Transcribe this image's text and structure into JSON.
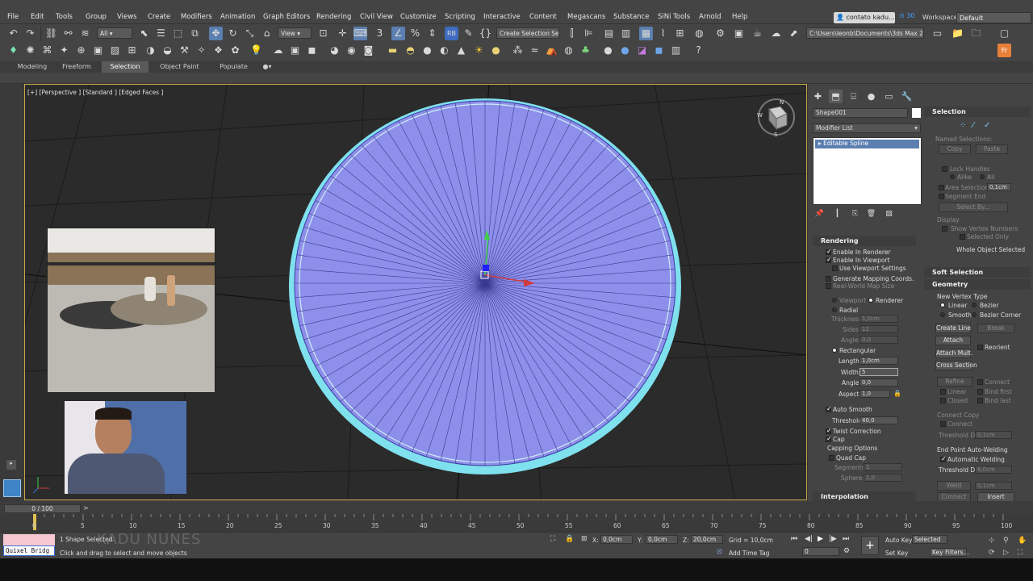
{
  "menu": [
    "File",
    "Edit",
    "Tools",
    "Group",
    "Views",
    "Create",
    "Modifiers",
    "Animation",
    "Graph Editors",
    "Rendering",
    "Civil View",
    "Customize",
    "Scripting",
    "Interactive",
    "Content",
    "Megascans",
    "Substance",
    "SiNi Tools",
    "Arnold",
    "Help"
  ],
  "account": "contato kadu...",
  "help_count": "30",
  "workspaces_label": "Workspaces:",
  "workspace": "Default",
  "toolbar": {
    "filter": "All",
    "ref_coord": "View",
    "selection_set": "Create Selection Se",
    "project_path": "C:\\Users\\leonb\\Documents\\3ds Max 2021"
  },
  "ribbon_tabs": [
    "Modeling",
    "Freeform",
    "Selection",
    "Object Paint",
    "Populate"
  ],
  "viewport_label": "[+] [Perspective ] [Standard ] [Edged Faces ]",
  "viewcube": {
    "n": "N",
    "s": "S",
    "w": "W"
  },
  "command_panel": {
    "object_name": "Shape001",
    "modifier_list": "Modifier List",
    "stack_item": "Editable Spline",
    "rendering": {
      "title": "Rendering",
      "enable_renderer": "Enable In Renderer",
      "enable_viewport": "Enable In Viewport",
      "use_viewport_settings": "Use Viewport Settings",
      "gen_mapping": "Generate Mapping Coords.",
      "real_world": "Real-World Map Size",
      "viewport": "Viewport",
      "renderer": "Renderer",
      "radial": "Radial",
      "thickness_label": "Thickness:",
      "thickness": "1,0cm",
      "sides_label": "Sides:",
      "sides": "12",
      "angle_label": "Angle:",
      "angle": "0,0",
      "rectangular": "Rectangular",
      "length_label": "Length:",
      "length": "1,0cm",
      "width_label": "Width:",
      "width": "5",
      "angle2_label": "Angle:",
      "angle2": "0,0",
      "aspect_label": "Aspect:",
      "aspect": "1,0",
      "auto_smooth": "Auto Smooth",
      "threshold_label": "Threshold:",
      "threshold": "40,0",
      "twist_correction": "Twist Correction",
      "cap": "Cap",
      "capping_options": "Capping Options",
      "quad_cap": "Quad Cap",
      "segments_label": "Segments:",
      "segments": "1",
      "sphere_label": "Sphere:",
      "sphere": "1,0"
    },
    "interpolation": "Interpolation",
    "selection": {
      "title": "Selection",
      "named_selections": "Named Selections:",
      "copy": "Copy",
      "paste": "Paste",
      "lock_handles": "Lock Handles",
      "alike": "Alike",
      "all": "All",
      "area_selection": "Area Selection:",
      "area_value": "0,1cm",
      "segment_end": "Segment End",
      "select_by": "Select By...",
      "display": "Display",
      "show_vertex_numbers": "Show Vertex Numbers",
      "selected_only": "Selected Only",
      "whole_object": "Whole Object Selected"
    },
    "soft_selection": "Soft Selection",
    "geometry": {
      "title": "Geometry",
      "new_vertex_type": "New Vertex Type",
      "linear": "Linear",
      "bezier": "Bezier",
      "smooth": "Smooth",
      "bezier_corner": "Bezier Corner",
      "create_line": "Create Line",
      "break": "Break",
      "attach": "Attach",
      "reorient": "Reorient",
      "attach_mult": "Attach Mult.",
      "cross_section": "Cross Section",
      "refine": "Refine",
      "connect": "Connect",
      "linear2": "Linear",
      "bind_first": "Bind first",
      "closed": "Closed",
      "bind_last": "Bind last",
      "connect_copy": "Connect Copy",
      "connect2": "Connect",
      "threshold_dist": "Threshold Dist",
      "threshold_dist_value": "0,1cm",
      "end_point_welding": "End Point Auto-Welding",
      "automatic_welding": "Automatic Welding",
      "threshold_dist2": "Threshold Dist",
      "threshold_dist2_value": "6,0cm",
      "weld": "Weld",
      "weld_value": "0,1cm",
      "connect3": "Connect",
      "insert": "Insert"
    }
  },
  "timeline": {
    "frame": "0 / 100",
    "ticks": [
      "0",
      "5",
      "10",
      "15",
      "20",
      "25",
      "30",
      "35",
      "40",
      "45",
      "50",
      "55",
      "60",
      "65",
      "70",
      "75",
      "80",
      "85",
      "90",
      "95",
      "100"
    ]
  },
  "status": {
    "maxscript_label": "Quixel Bridg",
    "selected": "1 Shape Selected",
    "prompt": "Click and drag to select and move objects",
    "x_label": "X:",
    "x": "0,0cm",
    "y_label": "Y:",
    "y": "0,0cm",
    "z_label": "Z:",
    "z": "20,0cm",
    "grid": "Grid = 10,0cm",
    "add_time_tag": "Add Time Tag",
    "current_frame": "0",
    "auto_key": "Auto Key",
    "selected_set": "Selected",
    "set_key": "Set Key",
    "key_filters": "Key Filters..."
  },
  "watermark": "KADU NUNES",
  "colors": {
    "viewport_border": "#c9a64a",
    "disc_fill": "#8e8fea",
    "disc_rim": "#7fe0ee",
    "selection_blue": "#5b7fb0"
  }
}
